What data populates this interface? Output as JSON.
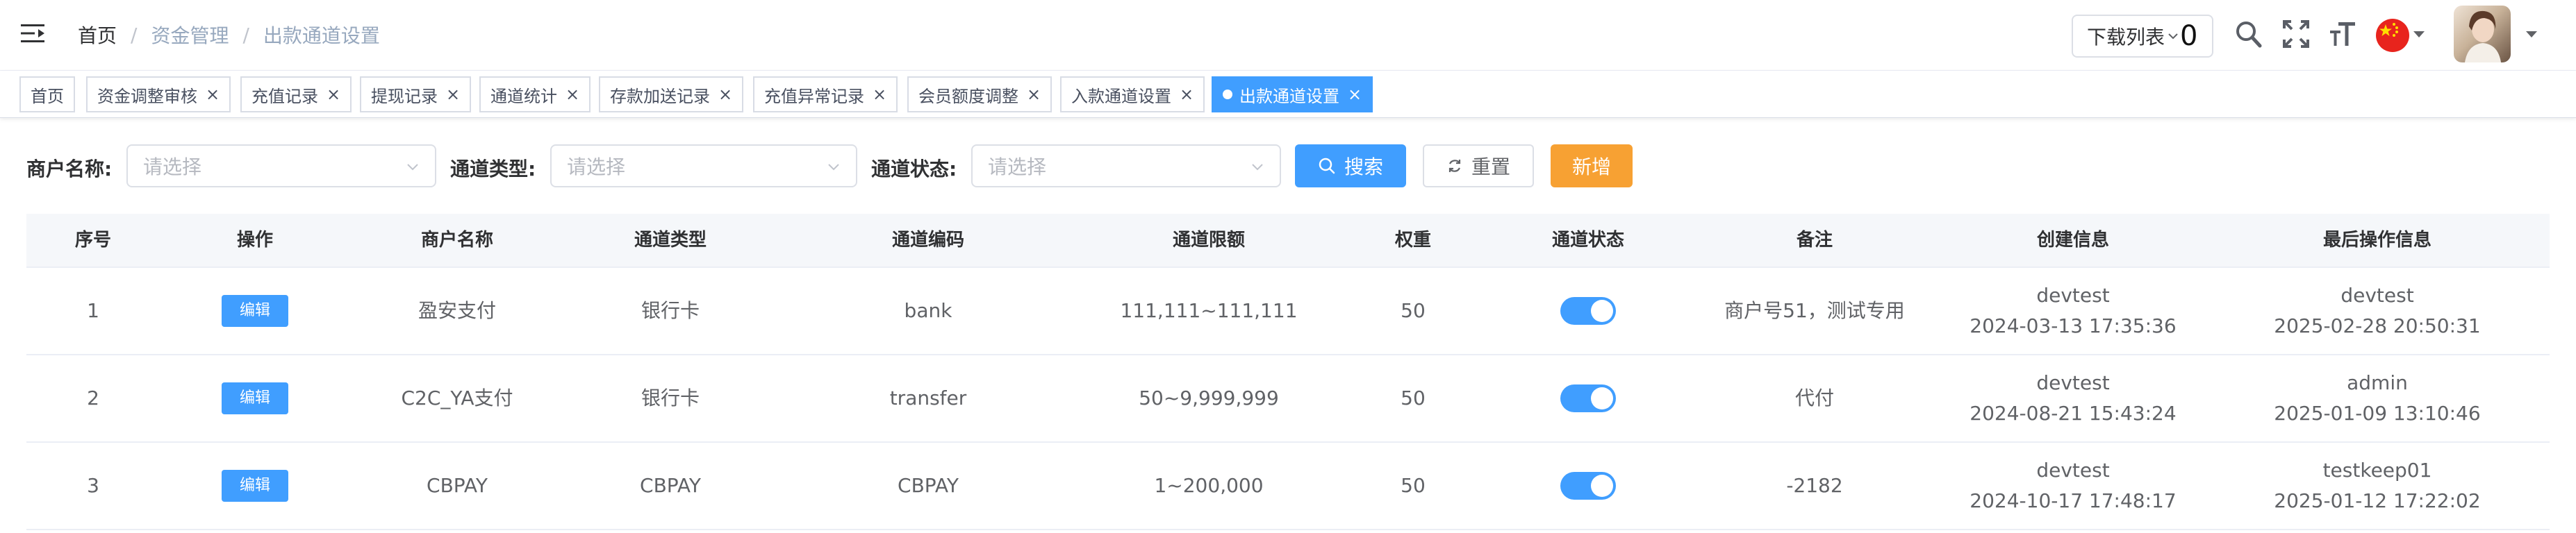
{
  "breadcrumb": {
    "home": "首页",
    "level2": "资金管理",
    "current": "出款通道设置"
  },
  "header": {
    "download_label": "下载列表",
    "download_count": "0"
  },
  "tags": [
    {
      "label": "首页",
      "active": false
    },
    {
      "label": "资金调整审核",
      "active": false
    },
    {
      "label": "充值记录",
      "active": false
    },
    {
      "label": "提现记录",
      "active": false
    },
    {
      "label": "通道统计",
      "active": false
    },
    {
      "label": "存款加送记录",
      "active": false
    },
    {
      "label": "充值异常记录",
      "active": false
    },
    {
      "label": "会员额度调整",
      "active": false
    },
    {
      "label": "入款通道设置",
      "active": false
    },
    {
      "label": "出款通道设置",
      "active": true
    }
  ],
  "filters": {
    "merchant_label": "商户名称:",
    "merchant_placeholder": "请选择",
    "type_label": "通道类型:",
    "type_placeholder": "请选择",
    "status_label": "通道状态:",
    "status_placeholder": "请选择",
    "search_label": "搜索",
    "reset_label": "重置",
    "add_label": "新增"
  },
  "table": {
    "headers": [
      "序号",
      "操作",
      "商户名称",
      "通道类型",
      "通道编码",
      "通道限额",
      "权重",
      "通道状态",
      "备注",
      "创建信息",
      "最后操作信息"
    ],
    "edit_label": "编辑",
    "rows": [
      {
        "index": "1",
        "merchant": "盈安支付",
        "type": "银行卡",
        "code": "bank",
        "limit": "111,111~111,111",
        "weight": "50",
        "status_on": true,
        "remark": "商户号51，测试专用",
        "created_by": "devtest",
        "created_at": "2024-03-13 17:35:36",
        "updated_by": "devtest",
        "updated_at": "2025-02-28 20:50:31"
      },
      {
        "index": "2",
        "merchant": "C2C_YA支付",
        "type": "银行卡",
        "code": "transfer",
        "limit": "50~9,999,999",
        "weight": "50",
        "status_on": true,
        "remark": "代付",
        "created_by": "devtest",
        "created_at": "2024-08-21 15:43:24",
        "updated_by": "admin",
        "updated_at": "2025-01-09 13:10:46"
      },
      {
        "index": "3",
        "merchant": "CBPAY",
        "type": "CBPAY",
        "code": "CBPAY",
        "limit": "1~200,000",
        "weight": "50",
        "status_on": true,
        "remark": "-2182",
        "created_by": "devtest",
        "created_at": "2024-10-17 17:48:17",
        "updated_by": "testkeep01",
        "updated_at": "2025-01-12 17:22:02"
      }
    ]
  },
  "colors": {
    "primary": "#409eff",
    "warning": "#f7a133",
    "header_bg": "#f5f7fa"
  }
}
